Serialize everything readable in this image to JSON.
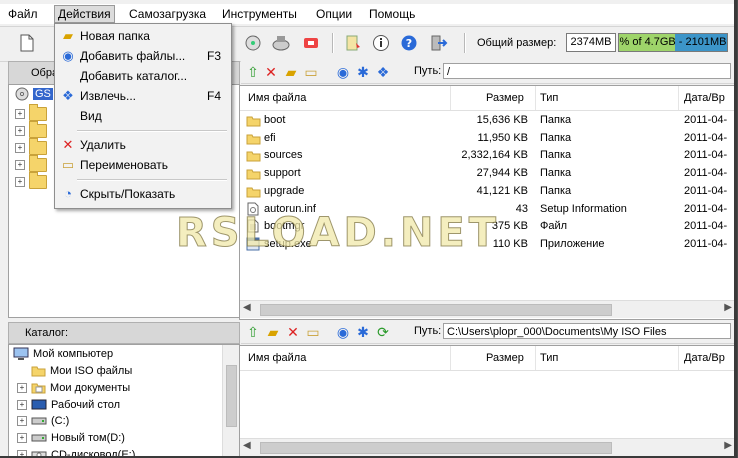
{
  "menu": [
    "Файл",
    "Действия",
    "Самозагрузка",
    "Инструменты",
    "Опции",
    "Помощь"
  ],
  "toolbar": {
    "size_label": "Общий размер:",
    "size_value": "2374MB",
    "capacity_text": "% of 4.7GB - 2101MB",
    "capacity_fraction": 0.52
  },
  "left_panel": {
    "header": "Обра",
    "root": "GS"
  },
  "dropdown": [
    {
      "label": "Новая папка",
      "key": "",
      "icon": "new-folder-icon"
    },
    {
      "label": "Добавить файлы...",
      "key": "F3",
      "icon": "add-files-icon"
    },
    {
      "label": "Добавить каталог...",
      "key": "",
      "icon": ""
    },
    {
      "label": "Извлечь...",
      "key": "F4",
      "icon": "extract-icon"
    },
    {
      "label": "Вид",
      "key": "",
      "icon": ""
    },
    {
      "label": "Удалить",
      "key": "",
      "icon": "delete-icon"
    },
    {
      "label": "Переименовать",
      "key": "",
      "icon": "rename-icon"
    },
    {
      "label": "Скрыть/Показать",
      "key": "",
      "icon": "hide-show-icon"
    }
  ],
  "top_path": {
    "label": "Путь:",
    "value": "/"
  },
  "columns": {
    "name": "Имя файла",
    "size": "Размер",
    "type": "Тип",
    "date": "Дата/Вр"
  },
  "files": [
    {
      "name": "boot",
      "size": "15,636 KB",
      "type": "Папка",
      "date": "2011-04-",
      "icon": "folder"
    },
    {
      "name": "efi",
      "size": "11,950 KB",
      "type": "Папка",
      "date": "2011-04-",
      "icon": "folder"
    },
    {
      "name": "sources",
      "size": "2,332,164 KB",
      "type": "Папка",
      "date": "2011-04-",
      "icon": "folder"
    },
    {
      "name": "support",
      "size": "27,944 KB",
      "type": "Папка",
      "date": "2011-04-",
      "icon": "folder"
    },
    {
      "name": "upgrade",
      "size": "41,121 KB",
      "type": "Папка",
      "date": "2011-04-",
      "icon": "folder"
    },
    {
      "name": "autorun.inf",
      "size": "43",
      "type": "Setup Information",
      "date": "2011-04-",
      "icon": "inf"
    },
    {
      "name": "bootmgr",
      "size": "375 KB",
      "type": "Файл",
      "date": "2011-04-",
      "icon": "file"
    },
    {
      "name": "setup.exe",
      "size": "110 KB",
      "type": "Приложение",
      "date": "2011-04-",
      "icon": "exe"
    }
  ],
  "catalog": {
    "header": "Каталог:",
    "items": [
      {
        "label": "Мой компьютер",
        "level": 0,
        "icon": "computer-icon"
      },
      {
        "label": "Мои ISO файлы",
        "level": 1,
        "icon": "folder-icon"
      },
      {
        "label": "Мои документы",
        "level": 1,
        "icon": "documents-icon"
      },
      {
        "label": "Рабочий стол",
        "level": 1,
        "icon": "desktop-icon"
      },
      {
        "label": "(C:)",
        "level": 1,
        "icon": "drive-icon"
      },
      {
        "label": "Новый том(D:)",
        "level": 1,
        "icon": "drive-icon"
      },
      {
        "label": "CD-дисковод(E:)",
        "level": 1,
        "icon": "cd-drive-icon"
      }
    ]
  },
  "bottom_path": {
    "label": "Путь:",
    "value": "C:\\Users\\plopr_000\\Documents\\My ISO Files"
  },
  "watermark": "RSLOAD.NET"
}
